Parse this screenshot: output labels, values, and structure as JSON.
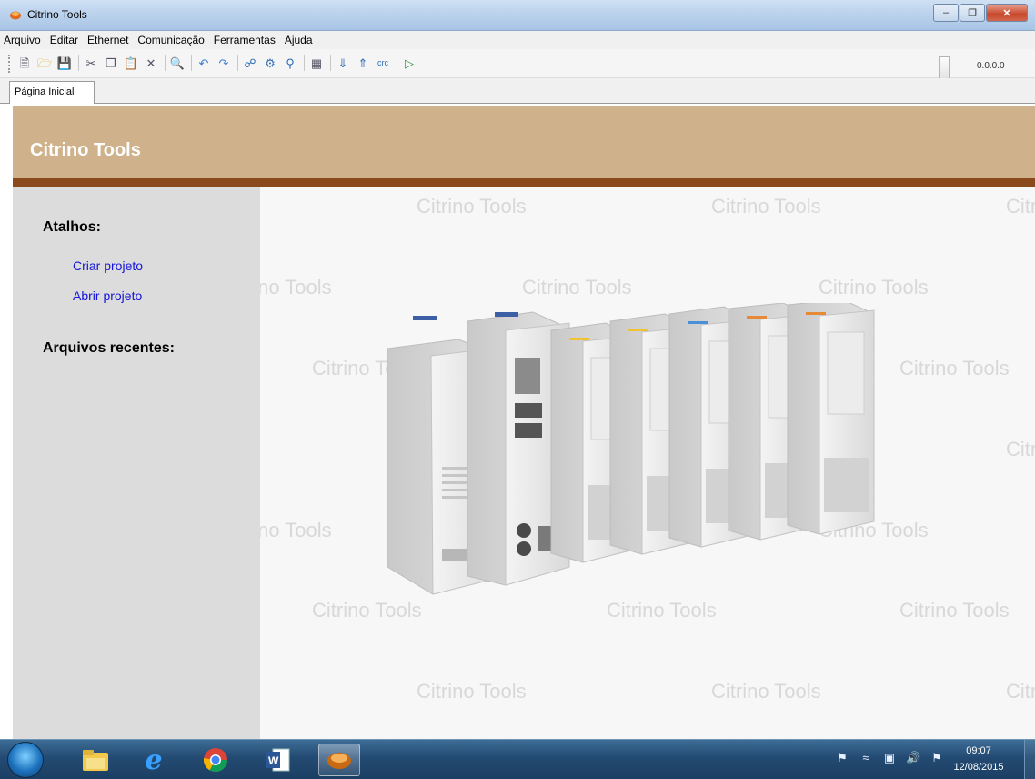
{
  "window": {
    "title": "Citrino Tools"
  },
  "menu": [
    "Arquivo",
    "Editar",
    "Ethernet",
    "Comunicação",
    "Ferramentas",
    "Ajuda"
  ],
  "toolbar": {
    "icons": [
      "new-file-icon",
      "open-folder-icon",
      "save-icon",
      "cut-icon",
      "copy-icon",
      "paste-icon",
      "delete-icon",
      "find-icon",
      "undo-icon",
      "redo-icon",
      "connect-icon",
      "settings-icon",
      "network-icon",
      "module-icon",
      "read-icon",
      "write-icon",
      "crc-icon",
      "run-icon"
    ],
    "ip_address": "0.0.0.0"
  },
  "tabs": [
    {
      "label": "Página Inicial",
      "active": true
    }
  ],
  "header": {
    "title": "Citrino Tools"
  },
  "sidebar": {
    "shortcuts_heading": "Atalhos:",
    "links": [
      "Criar projeto",
      "Abrir projeto"
    ],
    "recent_heading": "Arquivos recentes:"
  },
  "content": {
    "watermark_text": "Citrino Tools"
  },
  "taskbar": {
    "apps": [
      "start-orb-icon",
      "file-explorer-icon",
      "internet-explorer-icon",
      "chrome-icon",
      "word-icon",
      "citrino-tools-icon"
    ],
    "time": "09:07",
    "date": "12/08/2015"
  },
  "colors": {
    "header_band": "#cfb28c",
    "header_stripe": "#8b4a1c",
    "sidebar": "#dcdcdc",
    "link": "#1515d8"
  }
}
